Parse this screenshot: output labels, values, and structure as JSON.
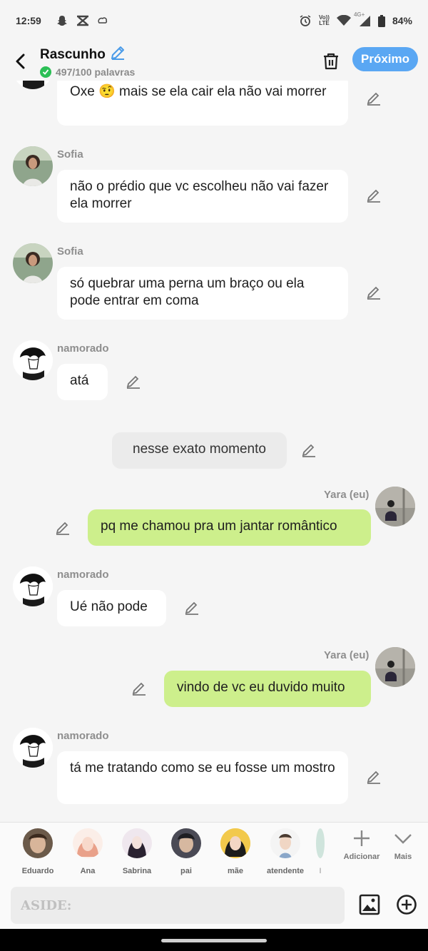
{
  "status": {
    "time": "12:59",
    "lte": "LTE",
    "volte": "Vo))",
    "net": "4G+",
    "battery": "84%"
  },
  "header": {
    "title": "Rascunho",
    "word_count": "497/100 palavras",
    "next_label": "Próximo"
  },
  "messages": [
    {
      "text": "Oxe 🤨 mais se ela cair ela não vai morrer"
    },
    {
      "sender": "Sofia",
      "text": "não o prédio que vc escolheu não vai fazer ela morrer"
    },
    {
      "sender": "Sofia",
      "text": "só quebrar uma perna um braço ou ela pode entrar em coma"
    },
    {
      "sender": "namorado",
      "text": "atá"
    },
    {
      "text": "nesse exato momento"
    },
    {
      "sender": "Yara (eu)",
      "text": "pq me chamou pra um jantar romântico"
    },
    {
      "sender": "namorado",
      "text": "Ué não pode"
    },
    {
      "sender": "Yara (eu)",
      "text": "vindo de vc eu duvido muito"
    },
    {
      "sender": "namorado",
      "text": "tá me tratando como se eu fosse um mostro"
    }
  ],
  "characters": [
    "Eduardo",
    "Ana",
    "Sabrina",
    "pai",
    "mãe",
    "atendente",
    "I"
  ],
  "tools": {
    "add": "Adicionar",
    "more": "Mais"
  },
  "input": {
    "placeholder": "ASIDE:"
  },
  "colors": {
    "accent": "#5aa7f3",
    "user_bubble": "#cdef8c",
    "check": "#2bbf55"
  }
}
